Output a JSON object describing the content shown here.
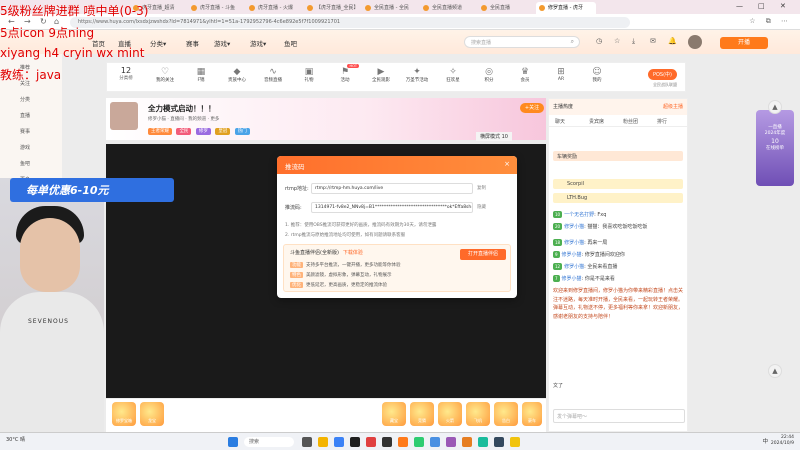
{
  "browser": {
    "tabs": [
      {
        "label": "虎牙直播_超清",
        "active": false
      },
      {
        "label": "虎牙直播 - 斗鱼",
        "active": false
      },
      {
        "label": "虎牙直播 - 火爆",
        "active": false
      },
      {
        "label": "【虎牙直播_全民】",
        "active": false
      },
      {
        "label": "全民直播 - 全民",
        "active": false
      },
      {
        "label": "全民直播频道",
        "active": false
      },
      {
        "label": "全民直播",
        "active": false
      },
      {
        "label": "修罗直播 - 虎牙",
        "active": true
      }
    ],
    "url": "https://www.huya.com/lxsdxjzwshdx?ld=7814971&ylhtl=1=51a-1792952796-4c6e892e5f7f1009921701",
    "window_controls": [
      "—",
      "□",
      "✕"
    ]
  },
  "site_header": {
    "nav": [
      "首页",
      "直播",
      "分类▾",
      "赛事",
      "游戏▾",
      "游戏▾",
      "鱼吧"
    ],
    "search_placeholder": "搜索直播",
    "icons": [
      {
        "label": "",
        "icon": "history-icon"
      },
      {
        "label": "",
        "icon": "star-icon"
      },
      {
        "label": "",
        "icon": "download-icon"
      },
      {
        "label": "",
        "icon": "message-icon"
      },
      {
        "label": "",
        "icon": "bell-icon"
      }
    ],
    "open_button": "开播"
  },
  "sidenav": [
    "推荐",
    "关注",
    "分类",
    "直播",
    "赛事",
    "游戏",
    "鱼吧",
    "更多"
  ],
  "category_strip": {
    "level": "12",
    "level_label": "分类榜",
    "categories": [
      {
        "label": "我的关注",
        "icon": "heart-icon",
        "badge": ""
      },
      {
        "label": "F锦",
        "icon": "grid-icon",
        "badge": ""
      },
      {
        "label": "贵族中心",
        "icon": "gem-icon",
        "badge": ""
      },
      {
        "label": "音频直播",
        "icon": "wave-icon",
        "badge": ""
      },
      {
        "label": "礼物",
        "icon": "gift-icon",
        "badge": ""
      },
      {
        "label": "活动",
        "icon": "flag-icon",
        "badge": "HOT"
      },
      {
        "label": "全民观影",
        "icon": "film-icon",
        "badge": ""
      },
      {
        "label": "万圣节活动",
        "icon": "party-icon",
        "badge": ""
      },
      {
        "label": "狂欢星",
        "icon": "sparkle-icon",
        "badge": ""
      },
      {
        "label": "积分",
        "icon": "coin-icon",
        "badge": ""
      },
      {
        "label": "会员",
        "icon": "crown-icon",
        "badge": ""
      },
      {
        "label": "AR",
        "icon": "ar-icon",
        "badge": ""
      },
      {
        "label": "我的",
        "icon": "user-icon",
        "badge": ""
      }
    ],
    "pos_logo": "POS(中)",
    "pos_sub": "全民战队联盟"
  },
  "room": {
    "title": "全力模式启动！！！",
    "meta": "修罗小猫  ·  直播间  ·  我的频道  ·  更多",
    "tags": [
      "王者荣耀",
      "全民",
      "修罗",
      "皇冠",
      "热门"
    ],
    "follow_label": "+关注",
    "player_control": "横屏模式 10"
  },
  "right_panel": {
    "top_label": "主播热度",
    "top_value": "超级主播",
    "tabs": [
      "聊天",
      "贵宾席",
      "粉丝团",
      "排行"
    ],
    "cards": [
      {
        "label": "车辆奖励",
        "color": "#ffe8d6"
      },
      {
        "label": "Scorpil",
        "color": "#fff2c8"
      },
      {
        "label": "LTH.Bug",
        "color": "#fff2c8"
      }
    ],
    "chat": [
      {
        "nick": "一个无名打野",
        "text": "Fxq",
        "lvl": "10"
      },
      {
        "nick": "修罗小猫",
        "text": "猫猫：我喜欢吃饭吃饭吃饭",
        "lvl": "20"
      },
      {
        "nick": "修罗小猫",
        "text": "再来一局",
        "lvl": "18"
      },
      {
        "nick": "修罗小猫",
        "text": "修罗直播间欢迎你",
        "lvl": "9"
      },
      {
        "nick": "修罗小猫",
        "text": "全民来看直播",
        "lvl": "12"
      },
      {
        "nick": "修罗小猫",
        "text": "你是不是来看",
        "lvl": "7"
      }
    ],
    "long_message": "欢迎来到修罗直播间，修罗小猫为你带来精彩直播！点击关注不迷路，每天准时开播，全民来看，一起玩转王者荣耀。弹幕互动，礼物送不停，更多福利等你来拿！欢迎新朋友，感谢老朋友的支持与陪伴！",
    "input_placeholder": "发个弹幕吧～",
    "last_line": "文了"
  },
  "side_rank": {
    "title": "一直播",
    "subtitle": "2024年度",
    "value": "10",
    "footer": "在线榜单"
  },
  "modal": {
    "title": "推流码",
    "row1_label": "rtmp地址:",
    "row1_value": "rtmp://rtmp-hm.huya.com/live",
    "row2_label": "推流码:",
    "row2_value": "1314971-fv8e2_NNv8j=B1********************************ok*Effa8sh=L6",
    "copy_label": "复制",
    "hide_label": "隐藏",
    "note1": "1. 推荐：使用OBS推流可获得更好的画质，推流码有效期为30天，请勿泄露",
    "note2": "2. rtmp推流与原始推流地址均可使用，如有问题请联系客服",
    "promo_title": "斗鱼直播伴侣(全新版)",
    "promo_link": "下载体验",
    "promo_button": "打开直播伴侣",
    "promo_lines": [
      {
        "tag": "功能",
        "text": "支持多平台推流，一键开播，更多功能等你体验"
      },
      {
        "tag": "特色",
        "text": "美颜滤镜，虚拟形象，弹幕互动，礼物展示"
      },
      {
        "tag": "优化",
        "text": "更低延迟，更高画质，更稳定的推流体验"
      }
    ]
  },
  "webcam": {
    "banner": "每单优惠6-10元",
    "shirt_text": "SEVENOUS"
  },
  "overlay_text": [
    "5级粉丝牌进群 喷中单(0-3)",
    "5点icon 9点ning",
    "xiyang h4 cryin wx mint",
    "教练：java"
  ],
  "gifts": [
    "藏宝",
    "竞猜",
    "火箭",
    "飞机",
    "告白",
    "豪车",
    "星星"
  ],
  "gift_left": [
    "修罗宝箱",
    "龙宝"
  ],
  "taskbar": {
    "weather": "30°C 晴",
    "search": "搜索",
    "ime": "中",
    "time": "22:44",
    "date": "2024/10/9"
  }
}
